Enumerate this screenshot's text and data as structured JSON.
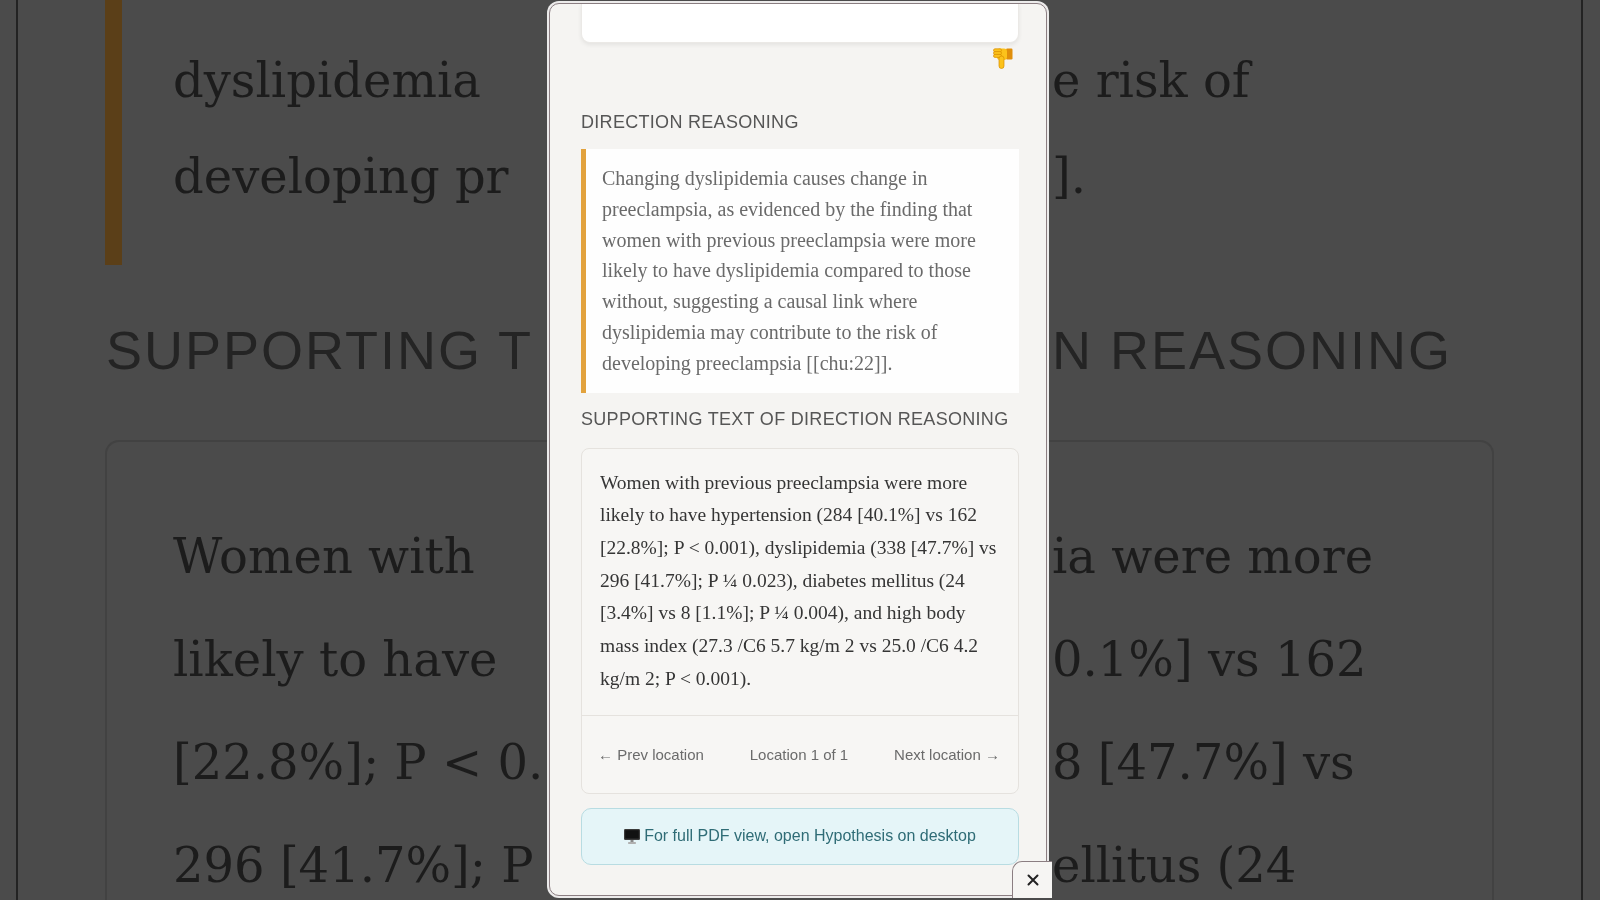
{
  "background_page": {
    "quote_rows": [
      {
        "left": "dyslipidemia",
        "right": "e risk of"
      },
      {
        "left": "developing pr",
        "right": "]."
      }
    ],
    "heading": {
      "left": "SUPPORTING T",
      "right": "N REASONING"
    },
    "body_rows": [
      {
        "left": "Women with",
        "right": "ia were more"
      },
      {
        "left": "likely to have",
        "right": "0.1%] vs 162"
      },
      {
        "left": "[22.8%]; P < 0.",
        "right": "8 [47.7%] vs"
      },
      {
        "left": "296 [41.7%]; P",
        "right": "ellitus (24"
      }
    ]
  },
  "modal": {
    "direction_reasoning": {
      "heading": "DIRECTION REASONING",
      "text": "Changing dyslipidemia causes change in preeclampsia, as evidenced by the finding that women with previous preeclampsia were more likely to have dyslipidemia compared to those without, suggesting a causal link where dyslipidemia may contribute to the risk of developing preeclampsia [[chu:22]]."
    },
    "supporting_text": {
      "heading": "SUPPORTING TEXT OF DIRECTION REASONING",
      "text": "Women with previous preeclampsia were more likely to have hypertension (284 [40.1%] vs 162 [22.8%]; P < 0.001), dyslipidemia (338 [47.7%] vs 296 [41.7%]; P ¼ 0.023), diabetes mellitus (24 [3.4%] vs 8 [1.1%]; P ¼ 0.004), and high body mass index (27.3 /C6 5.7 kg/m 2 vs 25.0 /C6 4.2 kg/m 2; P < 0.001).",
      "navigation": {
        "previous": "← Prev location",
        "position": "Location 1 of 1",
        "next": "Next location →"
      }
    },
    "desktop_notice": "For full PDF view, open Hypothesis on desktop"
  }
}
